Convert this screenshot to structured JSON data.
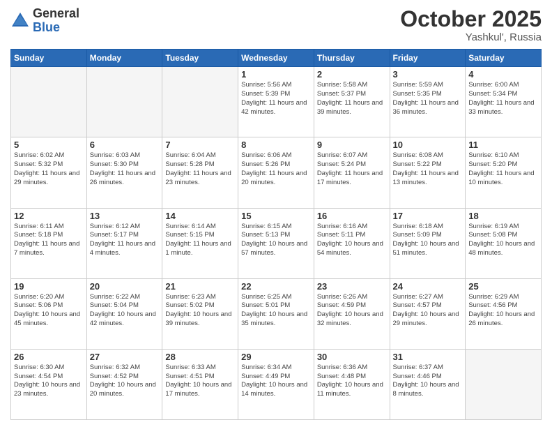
{
  "header": {
    "logo_general": "General",
    "logo_blue": "Blue",
    "month_title": "October 2025",
    "location": "Yashkul', Russia"
  },
  "days_of_week": [
    "Sunday",
    "Monday",
    "Tuesday",
    "Wednesday",
    "Thursday",
    "Friday",
    "Saturday"
  ],
  "weeks": [
    [
      {
        "day": "",
        "info": ""
      },
      {
        "day": "",
        "info": ""
      },
      {
        "day": "",
        "info": ""
      },
      {
        "day": "1",
        "info": "Sunrise: 5:56 AM\nSunset: 5:39 PM\nDaylight: 11 hours\nand 42 minutes."
      },
      {
        "day": "2",
        "info": "Sunrise: 5:58 AM\nSunset: 5:37 PM\nDaylight: 11 hours\nand 39 minutes."
      },
      {
        "day": "3",
        "info": "Sunrise: 5:59 AM\nSunset: 5:35 PM\nDaylight: 11 hours\nand 36 minutes."
      },
      {
        "day": "4",
        "info": "Sunrise: 6:00 AM\nSunset: 5:34 PM\nDaylight: 11 hours\nand 33 minutes."
      }
    ],
    [
      {
        "day": "5",
        "info": "Sunrise: 6:02 AM\nSunset: 5:32 PM\nDaylight: 11 hours\nand 29 minutes."
      },
      {
        "day": "6",
        "info": "Sunrise: 6:03 AM\nSunset: 5:30 PM\nDaylight: 11 hours\nand 26 minutes."
      },
      {
        "day": "7",
        "info": "Sunrise: 6:04 AM\nSunset: 5:28 PM\nDaylight: 11 hours\nand 23 minutes."
      },
      {
        "day": "8",
        "info": "Sunrise: 6:06 AM\nSunset: 5:26 PM\nDaylight: 11 hours\nand 20 minutes."
      },
      {
        "day": "9",
        "info": "Sunrise: 6:07 AM\nSunset: 5:24 PM\nDaylight: 11 hours\nand 17 minutes."
      },
      {
        "day": "10",
        "info": "Sunrise: 6:08 AM\nSunset: 5:22 PM\nDaylight: 11 hours\nand 13 minutes."
      },
      {
        "day": "11",
        "info": "Sunrise: 6:10 AM\nSunset: 5:20 PM\nDaylight: 11 hours\nand 10 minutes."
      }
    ],
    [
      {
        "day": "12",
        "info": "Sunrise: 6:11 AM\nSunset: 5:18 PM\nDaylight: 11 hours\nand 7 minutes."
      },
      {
        "day": "13",
        "info": "Sunrise: 6:12 AM\nSunset: 5:17 PM\nDaylight: 11 hours\nand 4 minutes."
      },
      {
        "day": "14",
        "info": "Sunrise: 6:14 AM\nSunset: 5:15 PM\nDaylight: 11 hours\nand 1 minute."
      },
      {
        "day": "15",
        "info": "Sunrise: 6:15 AM\nSunset: 5:13 PM\nDaylight: 10 hours\nand 57 minutes."
      },
      {
        "day": "16",
        "info": "Sunrise: 6:16 AM\nSunset: 5:11 PM\nDaylight: 10 hours\nand 54 minutes."
      },
      {
        "day": "17",
        "info": "Sunrise: 6:18 AM\nSunset: 5:09 PM\nDaylight: 10 hours\nand 51 minutes."
      },
      {
        "day": "18",
        "info": "Sunrise: 6:19 AM\nSunset: 5:08 PM\nDaylight: 10 hours\nand 48 minutes."
      }
    ],
    [
      {
        "day": "19",
        "info": "Sunrise: 6:20 AM\nSunset: 5:06 PM\nDaylight: 10 hours\nand 45 minutes."
      },
      {
        "day": "20",
        "info": "Sunrise: 6:22 AM\nSunset: 5:04 PM\nDaylight: 10 hours\nand 42 minutes."
      },
      {
        "day": "21",
        "info": "Sunrise: 6:23 AM\nSunset: 5:02 PM\nDaylight: 10 hours\nand 39 minutes."
      },
      {
        "day": "22",
        "info": "Sunrise: 6:25 AM\nSunset: 5:01 PM\nDaylight: 10 hours\nand 35 minutes."
      },
      {
        "day": "23",
        "info": "Sunrise: 6:26 AM\nSunset: 4:59 PM\nDaylight: 10 hours\nand 32 minutes."
      },
      {
        "day": "24",
        "info": "Sunrise: 6:27 AM\nSunset: 4:57 PM\nDaylight: 10 hours\nand 29 minutes."
      },
      {
        "day": "25",
        "info": "Sunrise: 6:29 AM\nSunset: 4:56 PM\nDaylight: 10 hours\nand 26 minutes."
      }
    ],
    [
      {
        "day": "26",
        "info": "Sunrise: 6:30 AM\nSunset: 4:54 PM\nDaylight: 10 hours\nand 23 minutes."
      },
      {
        "day": "27",
        "info": "Sunrise: 6:32 AM\nSunset: 4:52 PM\nDaylight: 10 hours\nand 20 minutes."
      },
      {
        "day": "28",
        "info": "Sunrise: 6:33 AM\nSunset: 4:51 PM\nDaylight: 10 hours\nand 17 minutes."
      },
      {
        "day": "29",
        "info": "Sunrise: 6:34 AM\nSunset: 4:49 PM\nDaylight: 10 hours\nand 14 minutes."
      },
      {
        "day": "30",
        "info": "Sunrise: 6:36 AM\nSunset: 4:48 PM\nDaylight: 10 hours\nand 11 minutes."
      },
      {
        "day": "31",
        "info": "Sunrise: 6:37 AM\nSunset: 4:46 PM\nDaylight: 10 hours\nand 8 minutes."
      },
      {
        "day": "",
        "info": ""
      }
    ]
  ]
}
